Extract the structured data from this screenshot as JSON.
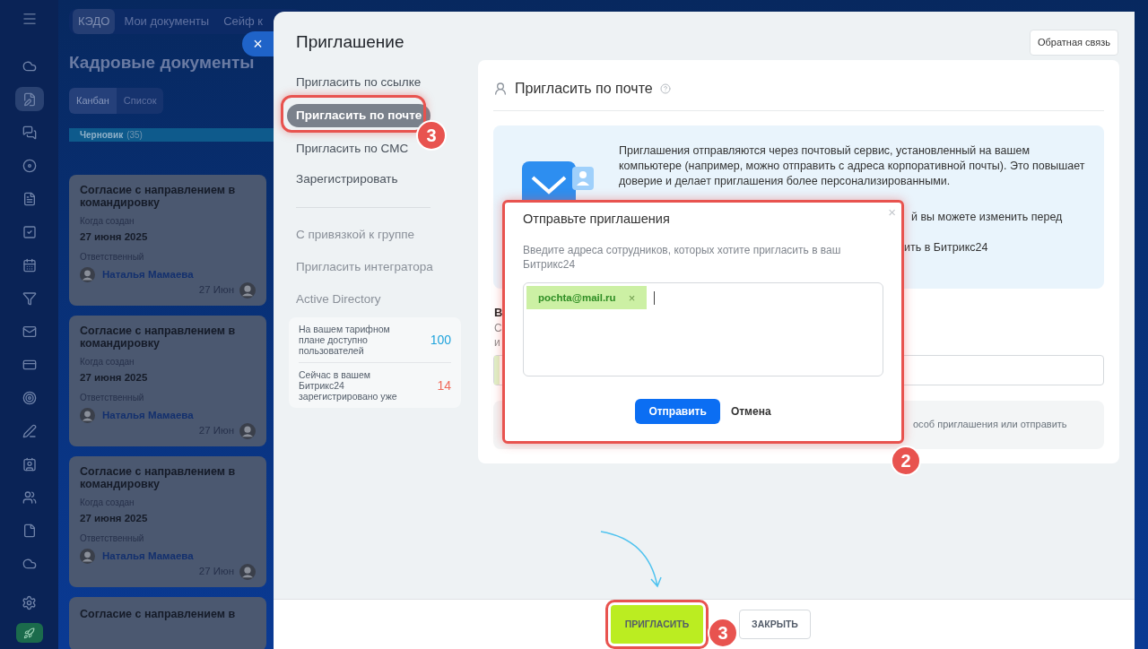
{
  "sidebar_icons": [
    {
      "selected": false
    },
    {
      "selected": true
    },
    {
      "selected": false
    },
    {
      "selected": false
    },
    {
      "selected": false
    },
    {
      "selected": false
    },
    {
      "selected": false
    },
    {
      "selected": false
    },
    {
      "selected": false
    },
    {
      "selected": false
    },
    {
      "selected": false
    },
    {
      "selected": false
    },
    {
      "selected": false
    },
    {
      "selected": false
    },
    {
      "selected": false
    },
    {
      "selected": false
    }
  ],
  "top_nav": [
    {
      "label": "КЭДО",
      "selected": true
    },
    {
      "label": "Мои документы",
      "selected": false
    },
    {
      "label": "Сейф к",
      "selected": false
    }
  ],
  "page_title": "Кадровые документы",
  "view_tabs": [
    {
      "label": "Канбан",
      "selected": true
    },
    {
      "label": "Список",
      "selected": false
    }
  ],
  "column": {
    "title": "Черновик",
    "count": "(35)"
  },
  "cards": [
    {
      "title": "Согласие с направлением в командировку",
      "created_label": "Когда создан",
      "created": "27 июня 2025",
      "responsible_label": "Ответственный",
      "responsible": "Наталья Мамаева",
      "date": "27 Июн"
    },
    {
      "title": "Согласие с направлением в командировку",
      "created_label": "Когда создан",
      "created": "27 июня 2025",
      "responsible_label": "Ответственный",
      "responsible": "Наталья Мамаева",
      "date": "27 Июн"
    },
    {
      "title": "Согласие с направлением в командировку",
      "created_label": "Когда создан",
      "created": "27 июня 2025",
      "responsible_label": "Ответственный",
      "responsible": "Наталья Мамаева",
      "date": "27 Июн"
    }
  ],
  "partial_card_title": "Согласие с направлением в",
  "panel": {
    "title": "Приглашение",
    "feedback_button": "Обратная связь",
    "nav": [
      {
        "label": "Пригласить по ссылке",
        "selected": false,
        "muted": false
      },
      {
        "label": "Пригласить по почте",
        "selected": true,
        "muted": false
      },
      {
        "label": "Пригласить по СМС",
        "selected": false,
        "muted": false
      },
      {
        "label": "Зарегистрировать",
        "selected": false,
        "muted": false
      }
    ],
    "nav_extra": [
      {
        "label": "С привязкой к группе",
        "selected": false,
        "muted": true
      },
      {
        "label": "Пригласить интегратора",
        "selected": false,
        "muted": true
      },
      {
        "label": "Active Directory",
        "selected": false,
        "muted": true
      }
    ],
    "stats": [
      {
        "label": "На вашем тарифном плане доступно пользователей",
        "value": "100",
        "color": "#1fa3dc"
      },
      {
        "label": "Сейчас в вашем Битрикс24 зарегистрировано уже",
        "value": "14",
        "color": "#f06a5a"
      }
    ]
  },
  "section": {
    "title": "Пригласить по почте",
    "info_text": "Приглашения отправляются через почтовый сервис, установленный на вашем компьютере (например, можно отправить с адреса корпоративной почты). Это повышает доверие и делает приглашения более персонализированными.",
    "info_fragments": [
      "й вы можете изменить перед",
      "ить в Битрикс24"
    ],
    "label_fragments": [
      "В",
      "С",
      "и"
    ],
    "note_fragment": "особ приглашения или отправить"
  },
  "dialog": {
    "title": "Отправьте приглашения",
    "hint": "Введите адреса сотрудников, которых хотите пригласить в ваш Битрикс24",
    "tags": [
      {
        "label": "pochta@mail.ru",
        "remove": "×"
      }
    ],
    "close": "×",
    "send_button": "Отправить",
    "cancel_button": "Отмена"
  },
  "footer": {
    "buttons": [
      {
        "label": "ПРИГЛАСИТЬ",
        "kind": "primary"
      },
      {
        "label": "ЗАКРЫТЬ",
        "kind": "secondary"
      }
    ]
  },
  "close_panel": "×",
  "annotations": [
    {
      "label": "3"
    },
    {
      "label": "2"
    },
    {
      "label": "3"
    }
  ]
}
